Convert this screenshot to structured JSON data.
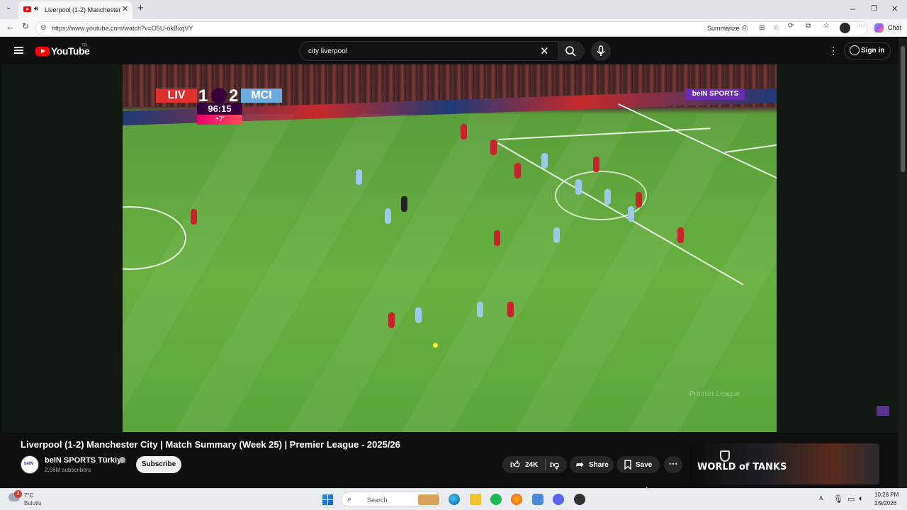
{
  "browser": {
    "tab_title": "Liverpool (1-2) Manchester Ci",
    "url": "https://www.youtube.com/watch?v=O5U-okBxqVY",
    "summarize_label": "Summarize",
    "chat_label": "Chat",
    "new_tab": "+",
    "minimize": "–",
    "restore": "❐",
    "close": "✕"
  },
  "youtube": {
    "logo_text": "YouTube",
    "country_code": "TR",
    "search_value": "city liverpool",
    "sign_in_label": "Sign in"
  },
  "video": {
    "score": {
      "home": "LIV",
      "home_goals": "1",
      "away_goals": "2",
      "away": "MCI",
      "clock": "96:15",
      "added_time": "+7'"
    },
    "broadcaster": "beIN SPORTS",
    "watermark": "Premier League"
  },
  "details": {
    "title": "Liverpool (1-2) Manchester City | Match Summary (Week 25) | Premier League - 2025/26",
    "channel_name": "beIN SPORTS Türkiye",
    "subscribers": "2.58M subscribers",
    "subscribe_label": "Subscribe",
    "likes": "24K",
    "share_label": "Share",
    "save_label": "Save",
    "more_label": "⋯"
  },
  "ad": {
    "brand": "WORLD of TANKS"
  },
  "taskbar": {
    "weather_temp": "7°C",
    "weather_condition": "Bulutlu",
    "weather_badge": "2",
    "search_label": "Search",
    "time": "10:28 PM",
    "date": "2/9/2026"
  }
}
